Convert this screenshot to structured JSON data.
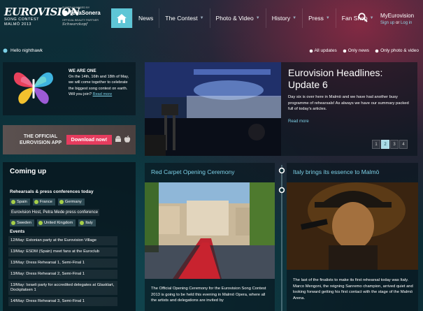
{
  "brand": {
    "logo_title": "EUROVISION",
    "logo_sub1": "SONG CONTEST",
    "logo_sub2": "MALMÖ 2013",
    "sponsor_label": "SUPER CHARGED BY",
    "sponsor_name": "TeliaSonera",
    "beauty_label": "OFFICIAL BEAUTY PARTNER",
    "beauty_name": "Schwarzkopf"
  },
  "nav": {
    "items": [
      {
        "label": "News",
        "has_caret": false
      },
      {
        "label": "The Contest",
        "has_caret": true
      },
      {
        "label": "Photo & Video",
        "has_caret": true
      },
      {
        "label": "History",
        "has_caret": true
      },
      {
        "label": "Press",
        "has_caret": true
      },
      {
        "label": "Fan Shop",
        "has_caret": true
      }
    ],
    "my_title": "MyEurovision",
    "sign_up": "Sign up",
    "or": "or",
    "log_in": "Log in"
  },
  "subbar": {
    "hello": "Hello nighthawk",
    "filters": [
      "All updates",
      "Only news",
      "Only photo & video"
    ]
  },
  "we_are_one": {
    "title": "WE ARE ONE",
    "body": "On the 14th, 16th and 18th of May, we will come together to celebrate the biggest song contest on earth. Will you join?",
    "link": "Read more"
  },
  "app": {
    "label_line1": "THE OFFICIAL",
    "label_line2": "EUROVISION APP",
    "button": "Download now!"
  },
  "coming_up": {
    "title": "Coming up",
    "section1": "Rehearsals & press conferences today",
    "tags_row1": [
      "Spain",
      "France",
      "Germany"
    ],
    "note": "Eurovision Host, Petra Mede press conference",
    "tags_row2": [
      "Sweden",
      "United Kingdom",
      "Italy"
    ],
    "section2": "Events",
    "events": [
      "12/May: Estonian party at the Eurovision Village",
      "13/May: ESDM (Spain) meet fans at the Euroclub",
      "13/May: Dress Rehearsal 1, Semi-Final 1",
      "13/May: Dress Rehearsal 2, Semi-Final 1",
      "13/May: Israeli party for accredited delegates at Glasklart, Dockplatsen 1",
      "14/May: Dress Rehearsal 3, Semi-Final 1"
    ]
  },
  "headline": {
    "title": "Eurovision Headlines: Update 6",
    "body": "Day six is over here in Malmö and we have had another busy programme of rehearsals! As always we have our summary packed full of today's articles.",
    "link": "Read more",
    "pages": [
      "1",
      "2",
      "3",
      "4"
    ],
    "active_page": "2"
  },
  "article1": {
    "title": "Red Carpet Opening Ceremony",
    "body": "The Official Opening Ceremony for the Eurovision Song Contest 2013 is going to be held this evening in Malmö Opera, where all the artists and delegations are invited by"
  },
  "article2": {
    "title": "Italy brings its essence to Malmö",
    "body": "The last of the finalists to make its first rehearsal today was Italy. Marco Mengoni, the reigning Sanremo champion, arrived quiet and looking forward getting his first contact with the stage of the Malmö Arena."
  },
  "colors": {
    "accent": "#5ec6d6",
    "link": "#7cd0e6",
    "cta": "#e63c5e",
    "check": "#a6cf48"
  }
}
